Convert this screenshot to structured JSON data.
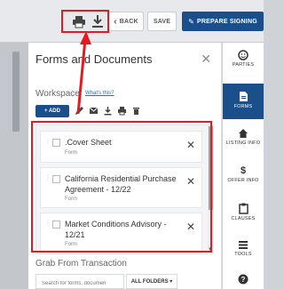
{
  "toolbar": {
    "back_label": "BACK",
    "save_label": "SAVE",
    "prepare_label": "PREPARE SIGNING"
  },
  "panel": {
    "title": "Forms and Documents",
    "workspace_label": "Workspace",
    "whats_this": "What's this?",
    "add_label": "+ ADD",
    "documents": [
      {
        "name": ".Cover Sheet",
        "type": "Form"
      },
      {
        "name": "California Residential Purchase Agreement - 12/22",
        "type": "Form"
      },
      {
        "name": "Market Conditions Advisory - 12/21",
        "type": "Form"
      }
    ],
    "grab_label": "Grab From Transaction",
    "search_placeholder": "Search for forms, documen",
    "folders_label": "ALL FOLDERS ▾"
  },
  "right_nav": {
    "items": [
      {
        "label": "PARTIES",
        "icon": "parties-icon"
      },
      {
        "label": "FORMS",
        "icon": "forms-icon",
        "active": true
      },
      {
        "label": "LISTING INFO",
        "icon": "home-icon"
      },
      {
        "label": "OFFER INFO",
        "icon": "dollar-icon"
      },
      {
        "label": "CLAUSES",
        "icon": "clipboard-icon"
      },
      {
        "label": "TOOLS",
        "icon": "tools-icon"
      },
      {
        "label": "",
        "icon": "help-icon"
      }
    ]
  },
  "colors": {
    "primary": "#1a4f8c",
    "annotation": "#e11b22"
  }
}
